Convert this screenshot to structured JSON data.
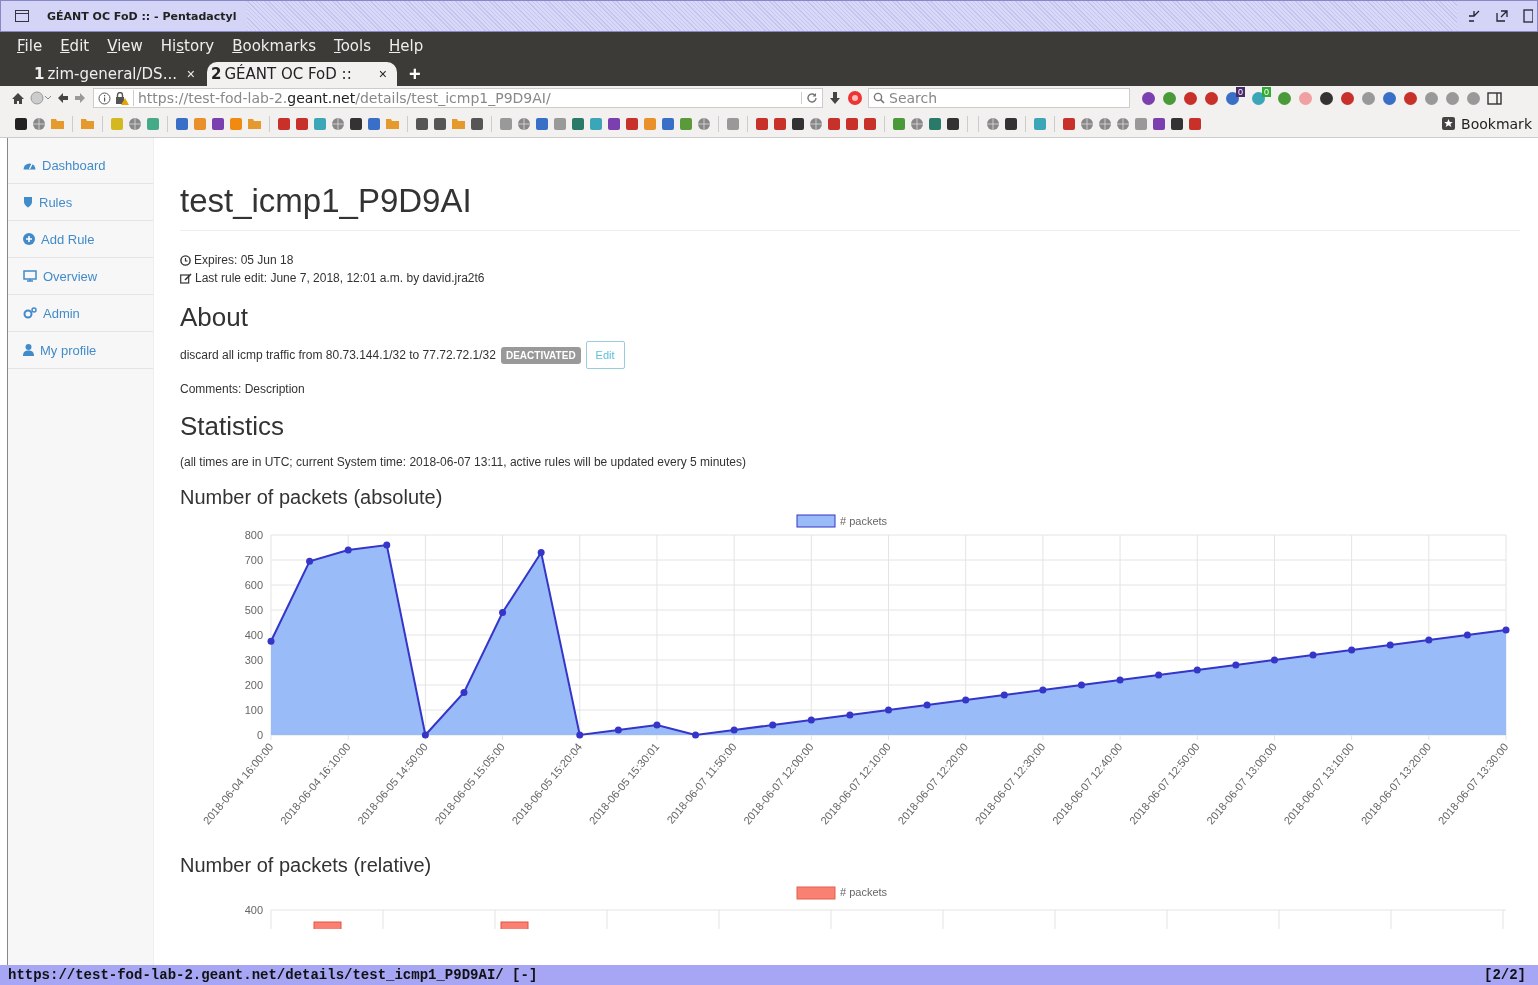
{
  "window": {
    "title": "GÉANT OC FoD :: - Pentadactyl"
  },
  "menu": [
    {
      "key": "F",
      "after": "ile"
    },
    {
      "key": "E",
      "after": "dit"
    },
    {
      "key": "V",
      "after": "iew"
    },
    {
      "before": "Hi",
      "key": "s",
      "after": "tory"
    },
    {
      "key": "B",
      "after": "ookmarks"
    },
    {
      "key": "T",
      "after": "ools"
    },
    {
      "key": "H",
      "after": "elp"
    }
  ],
  "tabs": [
    {
      "number": "1",
      "title": "zim-general/DS...",
      "close": "×",
      "selected": false
    },
    {
      "number": "2",
      "title": "GÉANT OC FoD ::",
      "close": "×",
      "selected": true
    }
  ],
  "new_tab": "+",
  "address_bar": {
    "prefix": "https://test-fod-lab-2.",
    "domain": "geant.net",
    "suffix": "/details/test_icmp1_P9D9AI/"
  },
  "search": {
    "placeholder": "Search"
  },
  "addon_badges": [
    "0",
    "0"
  ],
  "bookmarks_button": "Bookmark",
  "sidebar": {
    "items": [
      {
        "label": "Dashboard"
      },
      {
        "label": "Rules"
      },
      {
        "label": "Add Rule"
      },
      {
        "label": "Overview"
      },
      {
        "label": "Admin"
      },
      {
        "label": "My profile"
      }
    ]
  },
  "rule": {
    "name": "test_icmp1_P9D9AI",
    "expires": "Expires: 05 Jun 18",
    "last_edit": "Last rule edit: June 7, 2018, 12:01 a.m. by david.jra2t6"
  },
  "about": {
    "heading": "About",
    "description": "discard all icmp traffic from 80.73.144.1/32 to 77.72.72.1/32",
    "status": "DEACTIVATED",
    "edit_button": "Edit",
    "comments": "Comments: Description"
  },
  "statistics": {
    "heading": "Statistics",
    "note": "(all times are in UTC; current System time: 2018-06-07 13:11, active rules will be updated every 5 minutes)",
    "chart_data": {
      "type": "area",
      "title": "Number of packets (absolute)",
      "categories": [
        "2018-06-04 16:00:00",
        null,
        "2018-06-04 16:10:00",
        null,
        "2018-06-05 14:50:00",
        null,
        "2018-06-05 15:05:00",
        null,
        "2018-06-05 15:20:04",
        null,
        "2018-06-05 15:30:01",
        null,
        "2018-06-07 11:50:00",
        null,
        "2018-06-07 12:00:00",
        null,
        "2018-06-07 12:10:00",
        null,
        "2018-06-07 12:20:00",
        null,
        "2018-06-07 12:30:00",
        null,
        "2018-06-07 12:40:00",
        null,
        "2018-06-07 12:50:00",
        null,
        "2018-06-07 13:00:00",
        null,
        "2018-06-07 13:10:00",
        null,
        "2018-06-07 13:20:00",
        null,
        "2018-06-07 13:30:00"
      ],
      "series": [
        {
          "name": "# packets",
          "color": "#3535c8",
          "values": [
            375,
            695,
            740,
            760,
            0,
            170,
            490,
            730,
            0,
            20,
            40,
            0,
            20,
            40,
            60,
            80,
            100,
            120,
            140,
            160,
            180,
            200,
            220,
            240,
            260,
            280,
            300,
            320,
            340,
            360,
            380,
            400,
            420
          ]
        }
      ],
      "ylim": [
        0,
        800
      ],
      "yticks": [
        0,
        100,
        200,
        300,
        400,
        500,
        600,
        700,
        800
      ],
      "grid": true
    },
    "relative_chart": {
      "title": "Number of packets (relative)",
      "legend": "# packets",
      "ytick": "400"
    }
  },
  "status_bar": {
    "url": "https://test-fod-lab-2.geant.net/details/test_icmp1_P9D9AI/ [-]",
    "position": "[2/2]"
  }
}
